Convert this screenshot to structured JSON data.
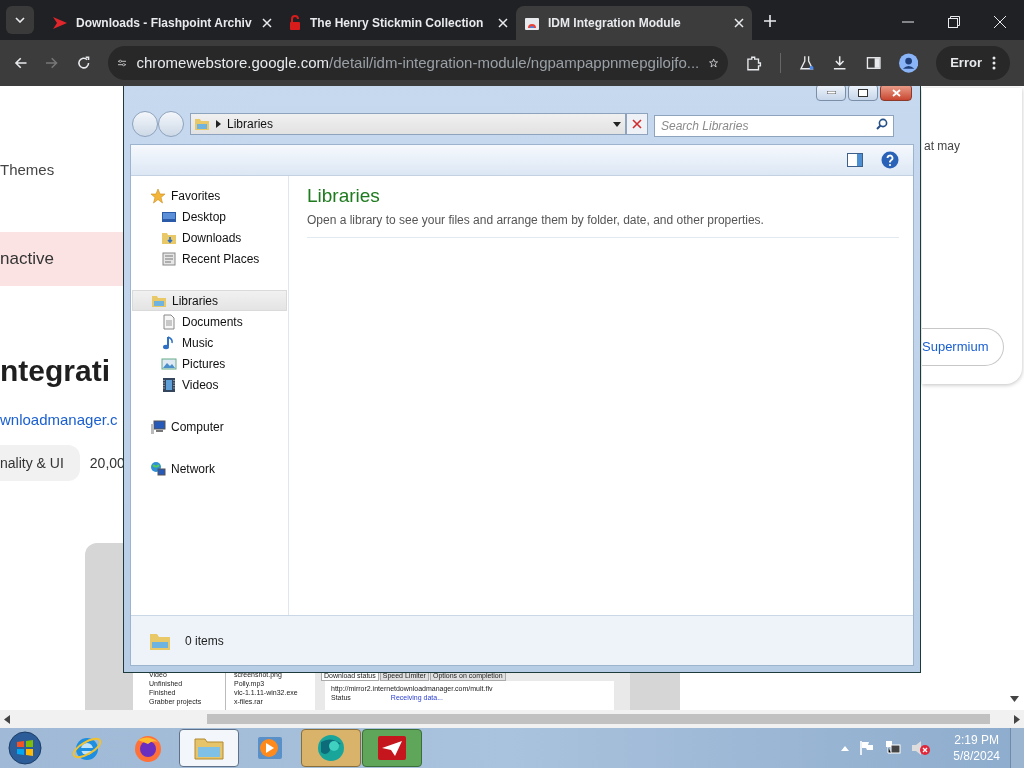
{
  "browser": {
    "tabs": [
      {
        "title": "Downloads - Flashpoint Archiv",
        "kind": "flashpoint",
        "selected": false
      },
      {
        "title": "The Henry Stickmin Collection",
        "kind": "lock",
        "selected": false
      },
      {
        "title": "IDM Integration Module",
        "kind": "store",
        "selected": true
      }
    ],
    "address": {
      "host": "chromewebstore.google.com",
      "path": "/detail/idm-integration-module/ngpampappnmepgilojfo..."
    },
    "profile_button": "Error"
  },
  "page": {
    "category_link": "Themes",
    "status_banner": "nactive",
    "title": "ntegrati",
    "website_link": "wnloadmanager.c",
    "category_chip": "nality & UI",
    "user_count": "20,00",
    "side_card": {
      "text": "at may",
      "button": "Supermium"
    },
    "idm_screenshot": {
      "tree": [
        "Video",
        "Unfinished",
        "Finished",
        "Grabber projects"
      ],
      "files": [
        "screenshot.png",
        "Polly.mp3",
        "vlc-1.1.11-win32.exe",
        "x-files.rar"
      ],
      "tabs": [
        {
          "label": "Download status",
          "selected": true
        },
        {
          "label": "Speed Limiter",
          "selected": false
        },
        {
          "label": "Options on completion",
          "selected": false
        }
      ],
      "url": "http://mirror2.internetdownloadmanager.com/mult.flv",
      "status_label": "Status",
      "status_value": "Receiving data..."
    }
  },
  "explorer": {
    "address": "Libraries",
    "search": {
      "placeholder": "Search Libraries"
    },
    "sidebar": [
      {
        "label": "Favorites",
        "kind": "star",
        "selected": false,
        "children": [
          {
            "label": "Desktop",
            "kind": "desktop",
            "selected": false
          },
          {
            "label": "Downloads",
            "kind": "downloads",
            "selected": false
          },
          {
            "label": "Recent Places",
            "kind": "recent",
            "selected": false
          }
        ]
      },
      {
        "label": "Libraries",
        "kind": "library",
        "selected": true,
        "children": [
          {
            "label": "Documents",
            "kind": "document",
            "selected": false
          },
          {
            "label": "Music",
            "kind": "music",
            "selected": false
          },
          {
            "label": "Pictures",
            "kind": "pictures",
            "selected": false
          },
          {
            "label": "Videos",
            "kind": "video",
            "selected": false
          }
        ]
      },
      {
        "label": "Computer",
        "kind": "computer",
        "selected": false
      },
      {
        "label": "Network",
        "kind": "network",
        "selected": false
      }
    ],
    "heading": "Libraries",
    "description": "Open a library to see your files and arrange them by folder, date, and other properties.",
    "status": "0 items"
  },
  "taskbar": {
    "apps": [
      {
        "kind": "ie",
        "open": false,
        "selected": false
      },
      {
        "kind": "firefox",
        "open": false,
        "selected": false
      },
      {
        "kind": "explorer",
        "open": true,
        "selected": true
      },
      {
        "kind": "media",
        "open": false,
        "selected": false
      },
      {
        "kind": "globe",
        "open": true,
        "selected": false
      },
      {
        "kind": "redapp",
        "open": true,
        "selected": false
      }
    ],
    "clock": {
      "time": "2:19 PM",
      "date": "5/8/2024"
    }
  }
}
